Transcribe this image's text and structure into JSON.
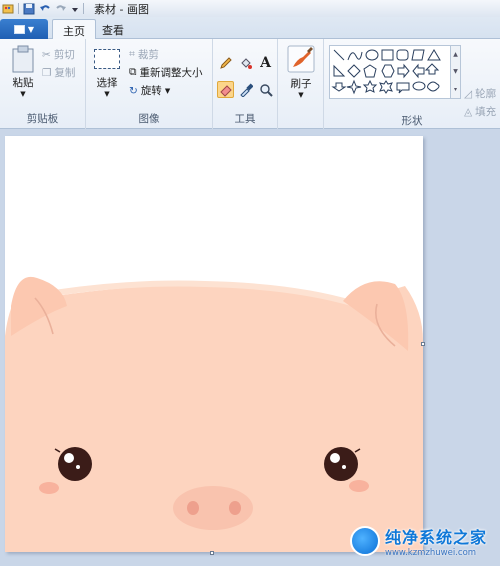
{
  "window": {
    "title": "素材 - 画图"
  },
  "tabs": [
    {
      "label": "主页",
      "active": true
    },
    {
      "label": "查看",
      "active": false
    }
  ],
  "ribbon": {
    "clipboard": {
      "label": "剪贴板",
      "paste_label": "粘贴",
      "cut_label": "剪切",
      "copy_label": "复制"
    },
    "image": {
      "label": "图像",
      "select_label": "选择",
      "crop_label": "裁剪",
      "resize_label": "重新调整大小",
      "rotate_label": "旋转"
    },
    "tools": {
      "label": "工具"
    },
    "brushes": {
      "label": "刷子"
    },
    "shapes": {
      "label": "形状",
      "outline_label": "轮廓",
      "fill_label": "填充"
    }
  },
  "watermark": {
    "title": "纯净系统之家",
    "url": "www.kzmzhuwei.com"
  },
  "colors": {
    "accent": "#1f5fb3",
    "pig_skin": "#fdd4bf",
    "pig_snout": "#f9c3ae",
    "pig_cheek": "#f5a48f",
    "eye": "#3b1c18"
  }
}
